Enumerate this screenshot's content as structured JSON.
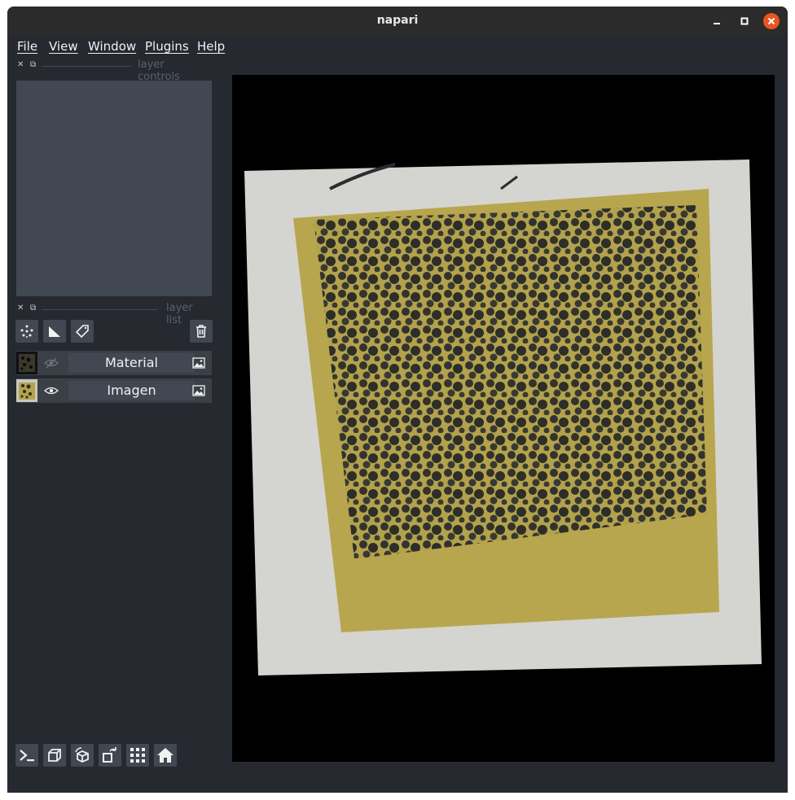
{
  "window": {
    "title": "napari"
  },
  "menubar": {
    "items": [
      "File",
      "View",
      "Window",
      "Plugins",
      "Help"
    ]
  },
  "docks": {
    "layer_controls_label": "layer controls",
    "layer_list_label": "layer list"
  },
  "layers": [
    {
      "name": "Material",
      "visible": false,
      "type": "image"
    },
    {
      "name": "Imagen",
      "visible": true,
      "type": "image"
    }
  ],
  "colors": {
    "bg": "#262930",
    "panel": "#414851",
    "accent_close": "#e95420"
  }
}
